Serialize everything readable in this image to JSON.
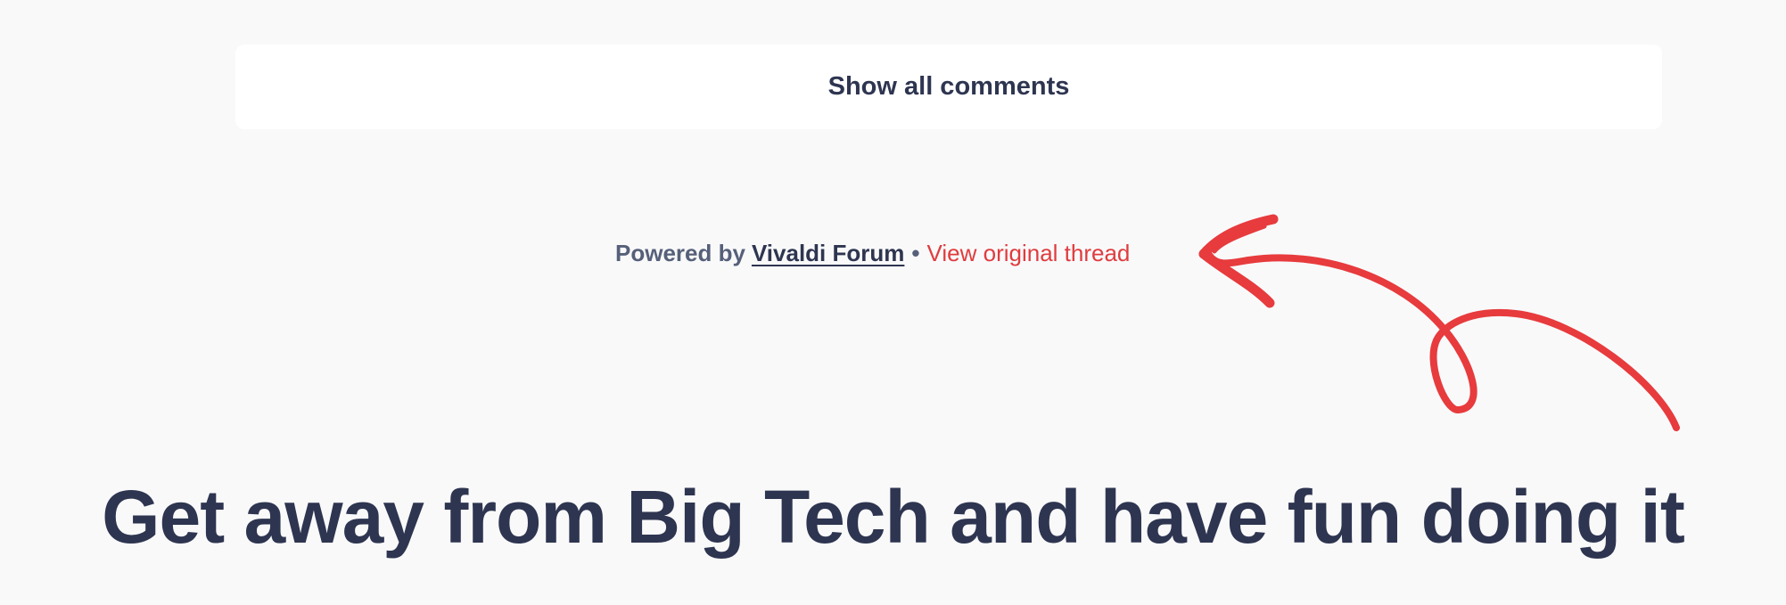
{
  "comments": {
    "show_all_label": "Show all comments"
  },
  "footer": {
    "powered_prefix": "Powered by",
    "forum_link": "Vivaldi Forum",
    "separator": "•",
    "thread_link": "View original thread"
  },
  "headline": {
    "text": "Get away from Big Tech and have fun doing it"
  },
  "colors": {
    "background": "#f9f9fa",
    "text_dark": "#2e3550",
    "accent_red": "#e03c3e"
  },
  "icons": {
    "annotation": "hand-drawn-arrow-icon"
  }
}
